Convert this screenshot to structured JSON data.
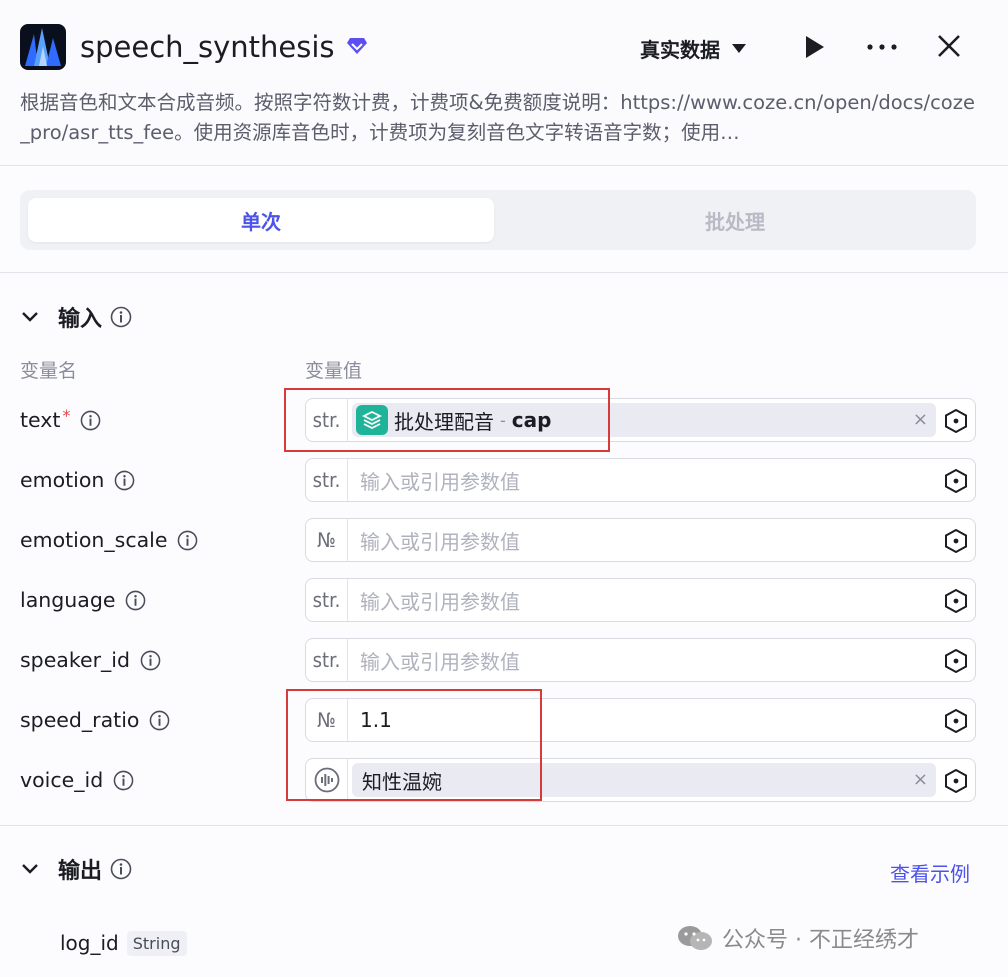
{
  "header": {
    "title": "speech_synthesis",
    "mode": "真实数据",
    "description": "根据音色和文本合成音频。按照字符数计费，计费项&免费额度说明：https://www.coze.cn/open/docs/coze_pro/asr_tts_fee。使用资源库音色时，计费项为复刻音色文字转语音字数；使用…"
  },
  "tabs": [
    {
      "label": "单次",
      "active": true
    },
    {
      "label": "批处理",
      "active": false
    }
  ],
  "input_section": {
    "title": "输入",
    "col_name": "变量名",
    "col_value": "变量值",
    "rows": [
      {
        "name": "text",
        "required": true,
        "type": "str.",
        "ref": {
          "node": "批处理配音",
          "field": "cap"
        }
      },
      {
        "name": "emotion",
        "type": "str.",
        "placeholder": "输入或引用参数值"
      },
      {
        "name": "emotion_scale",
        "type": "№",
        "placeholder": "输入或引用参数值"
      },
      {
        "name": "language",
        "type": "str.",
        "placeholder": "输入或引用参数值"
      },
      {
        "name": "speaker_id",
        "type": "str.",
        "placeholder": "输入或引用参数值"
      },
      {
        "name": "speed_ratio",
        "type": "№",
        "value": "1.1"
      },
      {
        "name": "voice_id",
        "type": "voice",
        "voice": "知性温婉"
      }
    ]
  },
  "output_section": {
    "title": "输出",
    "example_link": "查看示例",
    "fields": [
      {
        "name": "log_id",
        "type": "String"
      }
    ]
  },
  "watermark": {
    "text": "公众号 · 不正经绣才"
  },
  "colors": {
    "accent": "#4d53e8",
    "highlight": "#d63a3a",
    "ref_icon": "#1fb39a"
  }
}
